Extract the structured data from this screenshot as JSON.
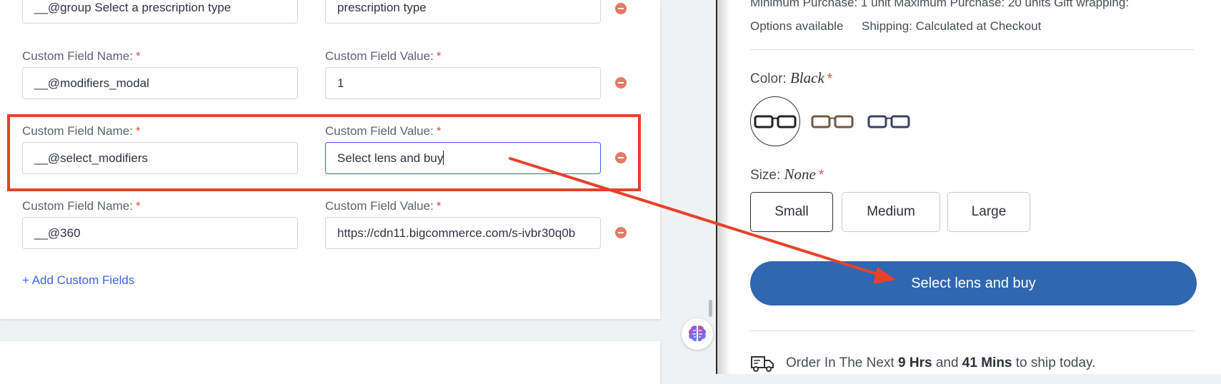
{
  "admin": {
    "fields": [
      {
        "name_label": "",
        "value_label": "",
        "name_value": "__@group Select a prescription type",
        "value_value": "prescription type"
      },
      {
        "name_label": "Custom Field Name:",
        "value_label": "Custom Field Value:",
        "name_value": "__@modifiers_modal",
        "value_value": "1"
      },
      {
        "name_label": "Custom Field Name:",
        "value_label": "Custom Field Value:",
        "name_value": "__@select_modifiers",
        "value_value": "Select lens and buy"
      },
      {
        "name_label": "Custom Field Name:",
        "value_label": "Custom Field Value:",
        "name_value": "__@360",
        "value_value": "https://cdn11.bigcommerce.com/s-ivbr30q0b"
      }
    ],
    "required_mark": "*",
    "add_link": "+ Add Custom Fields"
  },
  "store": {
    "top_line": "Minimum Purchase: 1 unit   Maximum Purchase: 20 units   Gift wrapping:",
    "options_available": "Options available",
    "shipping": "Shipping: Calculated at Checkout",
    "color_label": "Color:",
    "color_value": "Black",
    "size_label": "Size:",
    "size_value": "None",
    "required_mark": "*",
    "sizes": [
      "Small",
      "Medium",
      "Large"
    ],
    "selected_size": "Small",
    "buy_button": "Select lens and buy",
    "ship_prefix": "Order In The Next",
    "ship_hours": "9 Hrs",
    "ship_and": "and",
    "ship_mins": "41 Mins",
    "ship_suffix": "to ship today."
  },
  "colors": {
    "accent": "#3c64f4",
    "highlight": "#e8412a",
    "buy_button": "#2f67b0",
    "remove": "#e07d63"
  }
}
